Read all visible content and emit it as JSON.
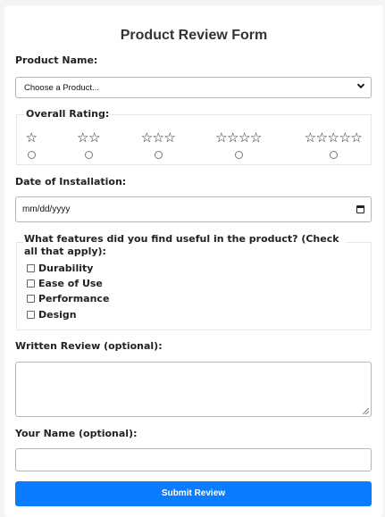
{
  "form": {
    "title": "Product Review Form",
    "product_label": "Product Name:",
    "product_select": {
      "value": "Choose a Product..."
    },
    "rating": {
      "legend": "Overall Rating:",
      "options": [
        {
          "stars": "☆"
        },
        {
          "stars": "☆☆"
        },
        {
          "stars": "☆☆☆"
        },
        {
          "stars": "☆☆☆☆"
        },
        {
          "stars": "☆☆☆☆☆"
        }
      ]
    },
    "date_label": "Date of Installation:",
    "date_input": {
      "placeholder": "mm/dd/yyyy"
    },
    "features": {
      "question": "What features did you find useful in the product? (Check all that apply):",
      "options": [
        "Durability",
        "Ease of Use",
        "Performance",
        "Design"
      ]
    },
    "review_label": "Written Review (optional):",
    "name_label": "Your Name (optional):",
    "submit_label": "Submit Review"
  },
  "colors": {
    "accent": "#0a7cff"
  },
  "icons": {
    "select_arrow": "chevron-down-icon",
    "date_picker": "calendar-icon"
  }
}
